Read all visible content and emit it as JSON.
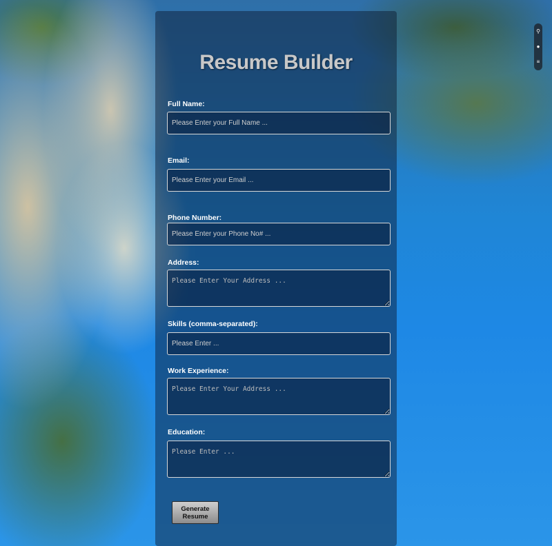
{
  "form": {
    "title": "Resume Builder",
    "fields": {
      "full_name": {
        "label": "Full Name:",
        "placeholder": "Please Enter your Full Name ..."
      },
      "email": {
        "label": "Email:",
        "placeholder": "Please Enter your Email ..."
      },
      "phone": {
        "label": "Phone Number:",
        "placeholder": "Please Enter your Phone No# ..."
      },
      "address": {
        "label": "Address:",
        "placeholder": "Please Enter Your Address ..."
      },
      "skills": {
        "label": "Skills (comma-separated):",
        "placeholder": "Please Enter ..."
      },
      "work_experience": {
        "label": "Work Experience:",
        "placeholder": "Please Enter Your Address ..."
      },
      "education": {
        "label": "Education:",
        "placeholder": "Please Enter ..."
      }
    },
    "submit_label": "Generate Resume"
  },
  "toolbar": {
    "icons": [
      "pin-icon",
      "dot-icon",
      "menu-icon"
    ],
    "glyphs": [
      "⚲",
      "●",
      "≡"
    ]
  }
}
